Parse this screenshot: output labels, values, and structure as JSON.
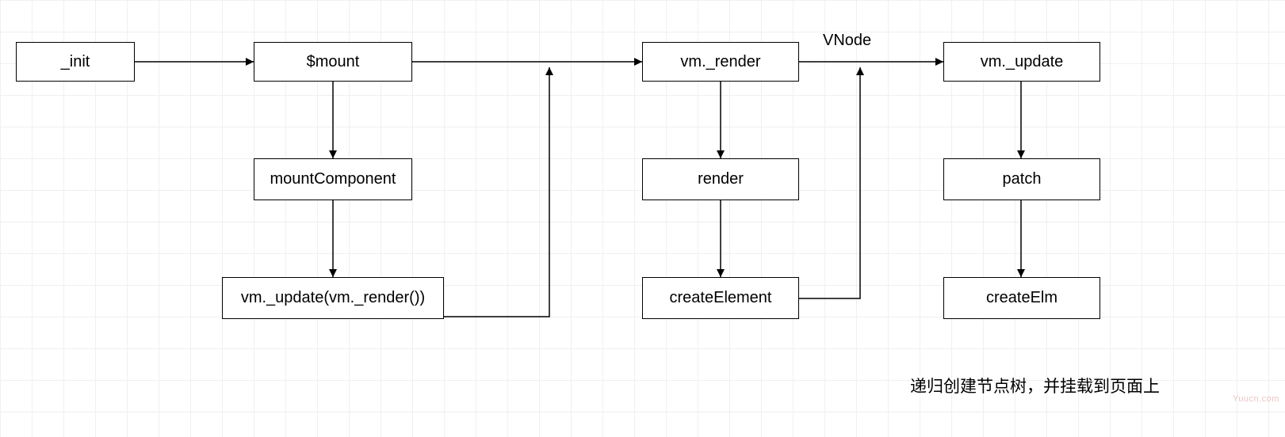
{
  "nodes": {
    "init": "_init",
    "mount": "$mount",
    "mountComponent": "mountComponent",
    "updateRender": "vm._update(vm._render())",
    "vmRender": "vm._render",
    "render": "render",
    "createElement": "createElement",
    "vmUpdate": "vm._update",
    "patch": "patch",
    "createElm": "createElm"
  },
  "edgeLabels": {
    "vnode": "VNode"
  },
  "notes": {
    "bottom": "递归创建节点树，并挂载到页面上"
  },
  "watermark": "Yuucn.com"
}
